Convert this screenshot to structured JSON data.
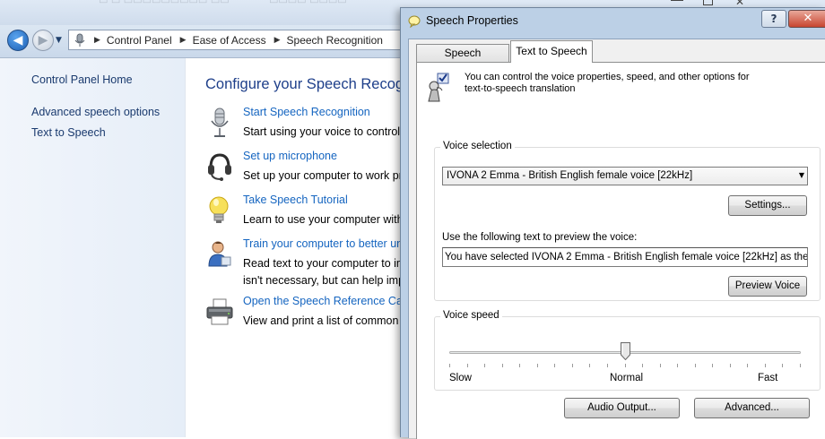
{
  "window": {
    "address": {
      "crumbs": [
        "Control Panel",
        "Ease of Access",
        "Speech Recognition"
      ]
    }
  },
  "left_pane": {
    "home_link": "Control Panel Home",
    "links": [
      "Advanced speech options",
      "Text to Speech"
    ]
  },
  "main": {
    "title": "Configure your Speech Recogn",
    "tasks": [
      {
        "icon": "microphone-icon",
        "link": "Start Speech Recognition",
        "desc": [
          "Start using your voice to control y"
        ]
      },
      {
        "icon": "headset-icon",
        "link": "Set up microphone",
        "desc": [
          "Set up your computer to work pro"
        ]
      },
      {
        "icon": "lightbulb-icon",
        "link": "Take Speech Tutorial",
        "desc": [
          "Learn to use your computer with"
        ]
      },
      {
        "icon": "user-train-icon",
        "link": "Train your computer to better un",
        "desc": [
          "Read text to your computer to im",
          "isn't necessary, but can help impr"
        ]
      },
      {
        "icon": "printer-icon",
        "link": "Open the Speech Reference Card",
        "desc": [
          "View and print a list of common c"
        ]
      }
    ]
  },
  "dialog": {
    "title": "Speech Properties",
    "help_label": "?",
    "close_label": "✕",
    "tabs": {
      "speech_recognition": "Speech Recognition",
      "text_to_speech": "Text to Speech"
    },
    "active_tab": "Text to Speech",
    "info_lines": [
      "You can control the voice properties, speed, and other options for",
      "text-to-speech translation"
    ],
    "voice_selection": {
      "group_label": "Voice selection",
      "selected_voice": "IVONA 2 Emma - British English female voice [22kHz]",
      "settings_button": "Settings...",
      "preview_label": "Use the following text to preview the voice:",
      "preview_text": "You have selected IVONA 2 Emma - British English female voice [22kHz] as the comp",
      "preview_button": "Preview Voice"
    },
    "voice_speed": {
      "group_label": "Voice speed",
      "slow_label": "Slow",
      "normal_label": "Normal",
      "fast_label": "Fast",
      "value": 0.5
    },
    "audio_output_button": "Audio Output...",
    "advanced_button": "Advanced..."
  }
}
